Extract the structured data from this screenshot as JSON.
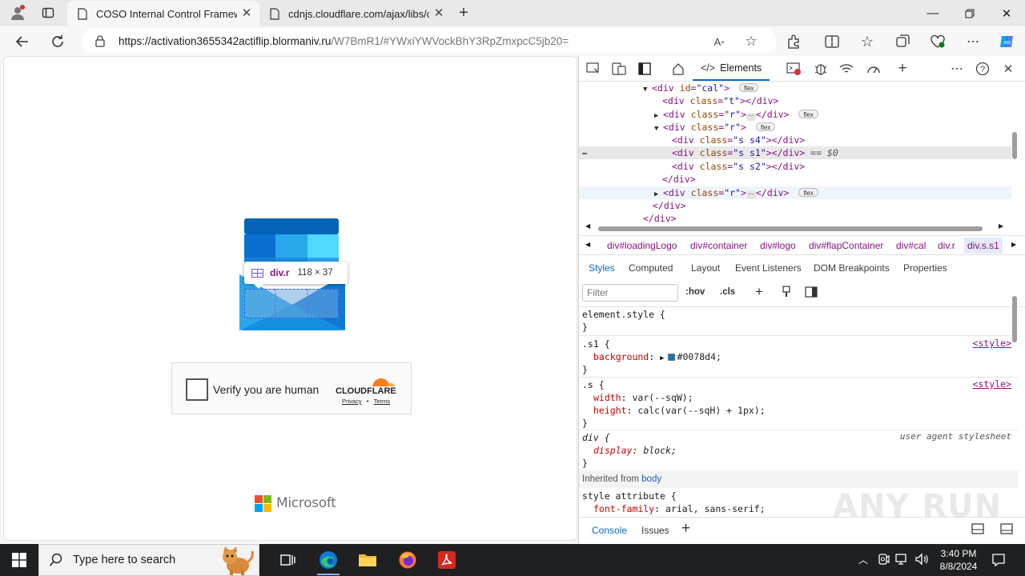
{
  "browser": {
    "tabs": [
      {
        "title": "COSO Internal Control Framewor",
        "active": true
      },
      {
        "title": "cdnjs.cloudflare.com/ajax/libs/c",
        "active": false
      }
    ],
    "url_host": "https://activation3655342actiflip.blormaniv.ru",
    "url_path": "/W7BmR1/#YWxiYWVockBhY3RpZmxpcC5jb20="
  },
  "page": {
    "tooltip": {
      "tag": "div.r",
      "size": "118 × 37"
    },
    "captcha": {
      "label": "Verify you are human",
      "brand": "CLOUDFLARE",
      "privacy": "Privacy",
      "dot": "•",
      "terms": "Terms"
    },
    "footer_brand": "Microsoft"
  },
  "devtools": {
    "active_tab": "Elements",
    "dom": {
      "l1_tag": "<div",
      "l1_attr": "id",
      "l1_val": "\"cal\"",
      "l1_end": ">",
      "l2": {
        "cls": "\"t\""
      },
      "l3": {
        "cls": "\"r\""
      },
      "l4": {
        "cls": "\"r\""
      },
      "l5": {
        "cls": "\"s s4\""
      },
      "l6": {
        "cls": "\"s s1\"",
        "eq": "== $0"
      },
      "l7": {
        "cls": "\"s s2\""
      },
      "l9": {
        "cls": "\"r\""
      },
      "flex": "flex",
      "ellipsis": "⋯",
      "close_div": "</div>"
    },
    "breadcrumbs": [
      "div#loadingLogo",
      "div#container",
      "div#logo",
      "div#flapContainer",
      "div#cal",
      "div.r",
      "div.s.s1"
    ],
    "subtabs": [
      "Styles",
      "Computed",
      "Layout",
      "Event Listeners",
      "DOM Breakpoints",
      "Properties"
    ],
    "filter_placeholder": "Filter",
    "filter_buttons": {
      "hov": ":hov",
      "cls": ".cls"
    },
    "styles": {
      "element_style": "element.style {",
      "close": "}",
      "rule1_sel": ".s1 {",
      "rule1_prop": "background",
      "rule1_val": "#0078d4;",
      "rule2_sel": ".s {",
      "rule2_p1": "width",
      "rule2_v1": "var(--sqW);",
      "rule2_p2": "height",
      "rule2_v2": "calc(var(--sqH) + 1px);",
      "rule3_sel": "div {",
      "rule3_prop": "display",
      "rule3_val": "block;",
      "ua_label": "user agent stylesheet",
      "source": "<style>",
      "inherited_label": "Inherited from",
      "inherited_from": "body",
      "rule4_sel": "style attribute {",
      "rule4_prop": "font-family",
      "rule4_val": "arial, sans-serif;"
    },
    "drawer_tabs": [
      "Console",
      "Issues"
    ]
  },
  "watermark": "ANY RUN",
  "taskbar": {
    "search_placeholder": "Type here to search",
    "time": "3:40 PM",
    "date": "8/8/2024"
  },
  "colors": {
    "accent": "#0f6cbd",
    "brand_blue": "#0078d4"
  }
}
